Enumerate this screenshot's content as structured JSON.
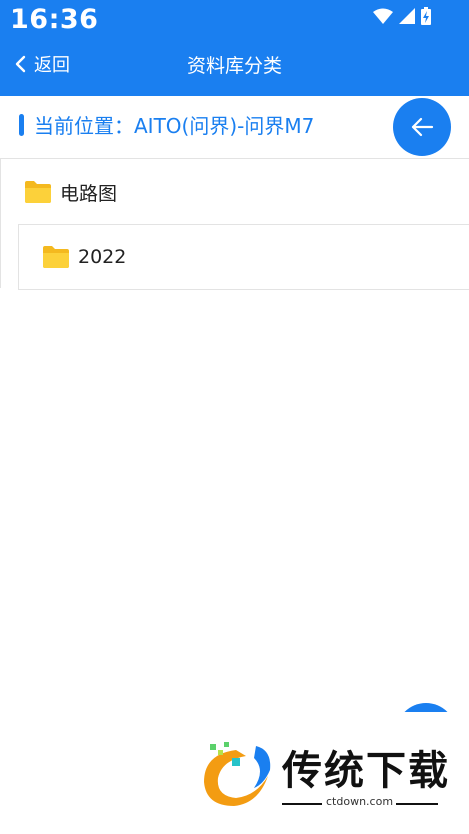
{
  "status_bar": {
    "time": "16:36"
  },
  "header": {
    "back_label": "返回",
    "title": "资料库分类"
  },
  "location": {
    "text": "当前位置：AITO(问界)-问界M7"
  },
  "tree": {
    "level1": {
      "label": "电路图"
    },
    "level2": {
      "label": "2022"
    }
  },
  "watermark": {
    "title": "传统下载",
    "subtitle": "ctdown.com"
  },
  "colors": {
    "primary": "#1a7ff0",
    "folder": "#f7c22b"
  }
}
